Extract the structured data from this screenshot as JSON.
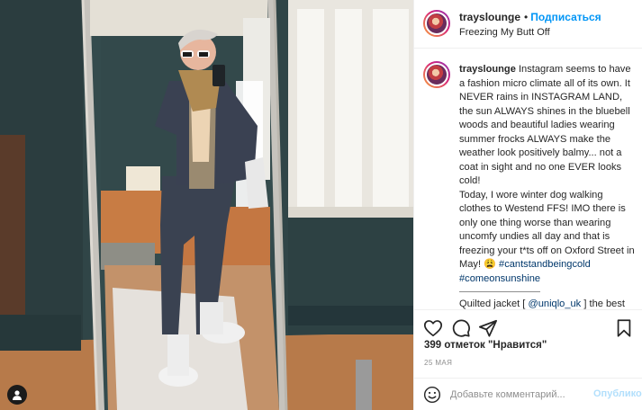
{
  "post": {
    "username": "trayslounge",
    "separator": "•",
    "follow_label": "Подписаться",
    "location": "Freezing My Butt Off",
    "caption": {
      "username": "trayslounge",
      "text1": " Instagram seems to have a fashion micro climate all of its own. It NEVER rains in INSTAGRAM LAND, the sun ALWAYS shines in the bluebell woods and beautiful ladies wearing summer frocks ALWAYS make the weather look positively balmy... not a coat in sight and no one EVER looks cold!",
      "text2": "Today, I wore winter dog walking clothes to Westend FFS! IMO there is only one thing worse than wearing uncomfy undies all day and that is freezing your t*ts off on Oxford Street in May! 😩",
      "hashtag1": "#cantstandbeingcold",
      "hashtag2": "#comeonsunshine",
      "text3_pre": "Quilted jacket [ ",
      "mention": "@uniqlo_uk",
      "text3_post": " ] the best and lightest but warm jacket ever. Perfect for dog walking, layering up"
    },
    "likes_text": "399 отметок \"Нравится\"",
    "date_text": "25 МАЯ",
    "comment": {
      "placeholder": "Добавьте комментарий...",
      "value": "",
      "post_label": "Опубликовать"
    }
  },
  "icons": {
    "like": "heart-icon",
    "comment": "comment-icon",
    "share": "paper-plane-icon",
    "save": "bookmark-icon",
    "emoji": "emoji-icon",
    "tagged_users": "user-tag-icon"
  },
  "colors": {
    "link_blue": "#0095f6",
    "hashtag": "#00376b",
    "muted": "#8e8e8e",
    "post_disabled": "#b2dffc",
    "border": "#efefef"
  }
}
